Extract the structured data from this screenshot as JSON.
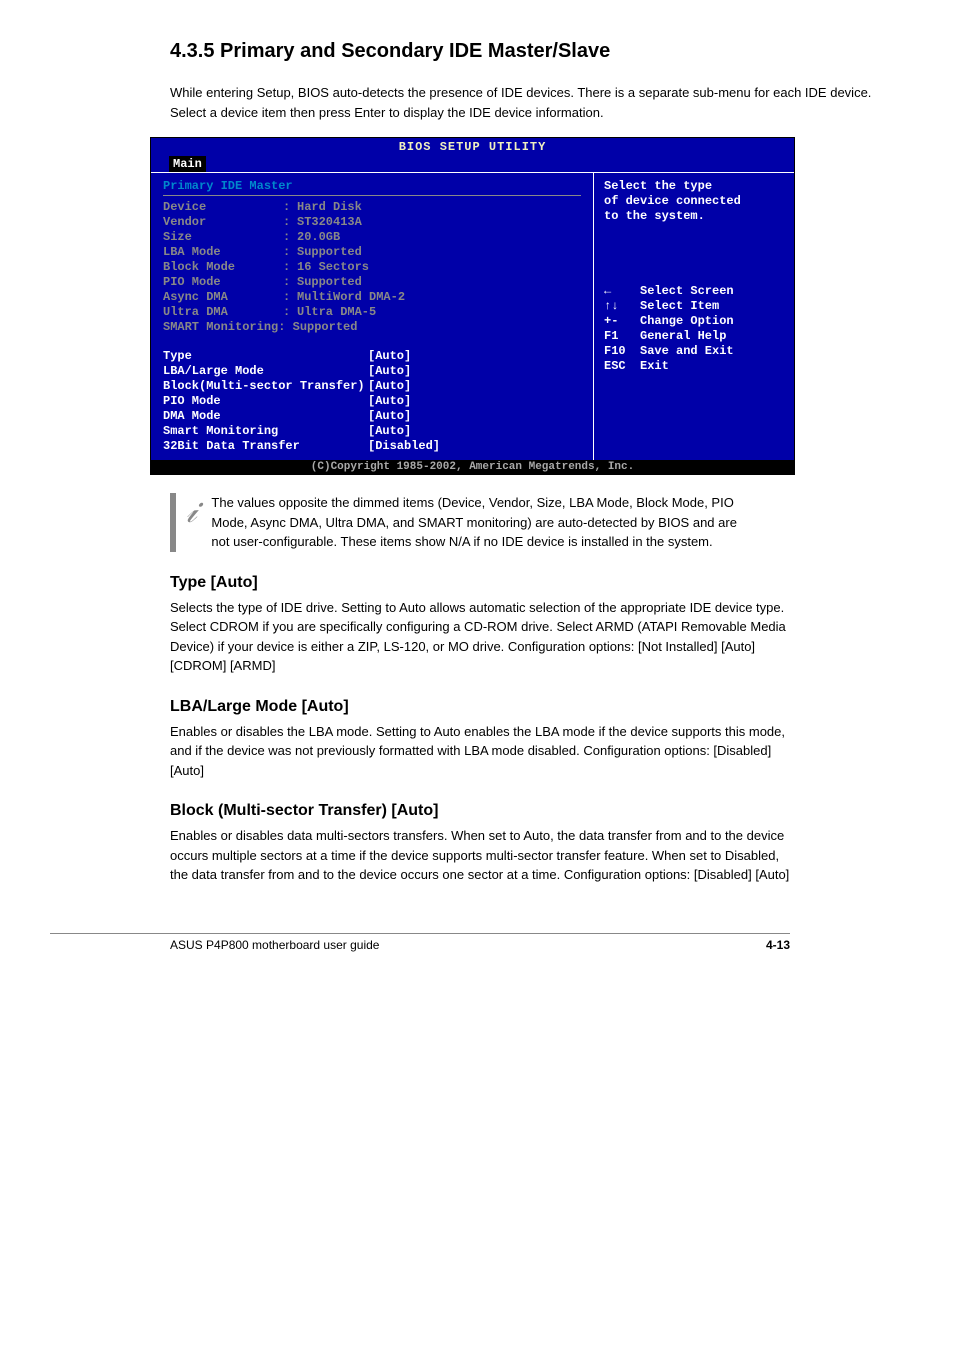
{
  "page": {
    "title": "4.3.5  Primary and Secondary IDE Master/Slave",
    "intro": "While entering Setup, BIOS auto-detects the presence of IDE devices. There is a separate sub-menu for each IDE device. Select a device item then press Enter to display the IDE device information."
  },
  "bios": {
    "title": "BIOS SETUP UTILITY",
    "tab": "Main",
    "section_title": "Primary IDE Master",
    "info": [
      {
        "label": "Device",
        "value": "Hard Disk"
      },
      {
        "label": "Vendor",
        "value": "ST320413A"
      },
      {
        "label": "Size",
        "value": "20.0GB"
      },
      {
        "label": "LBA Mode",
        "value": "Supported"
      },
      {
        "label": "Block Mode",
        "value": "16 Sectors"
      },
      {
        "label": "PIO Mode",
        "value": "Supported"
      },
      {
        "label": "Async DMA",
        "value": "MultiWord DMA-2"
      },
      {
        "label": "Ultra DMA",
        "value": "Ultra DMA-5"
      },
      {
        "label": "SMART Monitoring",
        "value": "Supported",
        "nogap": true
      }
    ],
    "settings": [
      {
        "label": "Type",
        "value": "[Auto]"
      },
      {
        "label": "LBA/Large Mode",
        "value": "[Auto]"
      },
      {
        "label": "Block(Multi-sector Transfer)",
        "value": "[Auto]"
      },
      {
        "label": "PIO Mode",
        "value": "[Auto]"
      },
      {
        "label": "DMA Mode",
        "value": "[Auto]"
      },
      {
        "label": "Smart Monitoring",
        "value": "[Auto]"
      },
      {
        "label": "32Bit Data Transfer",
        "value": "[Disabled]"
      }
    ],
    "help": {
      "line1": "Select the type",
      "line2": "of device connected",
      "line3": "to the system."
    },
    "nav": [
      {
        "key": "←",
        "desc": "Select Screen"
      },
      {
        "key": "↑↓",
        "desc": "Select Item"
      },
      {
        "key": "+-",
        "desc": "Change Option"
      },
      {
        "key": "F1",
        "desc": "General Help"
      },
      {
        "key": "F10",
        "desc": "Save and Exit"
      },
      {
        "key": "ESC",
        "desc": "Exit"
      }
    ],
    "footer": "(C)Copyright 1985-2002, American Megatrends, Inc."
  },
  "note": "The values opposite the dimmed items (Device, Vendor, Size, LBA Mode, Block Mode, PIO Mode, Async DMA, Ultra DMA, and SMART monitoring) are auto-detected by BIOS and are not user-configurable. These items show N/A if no IDE device is installed in the system.",
  "sections": [
    {
      "heading": "Type [Auto]",
      "body": "Selects the type of IDE drive. Setting to Auto allows automatic selection of the appropriate IDE device type. Select CDROM if you are specifically configuring a CD-ROM drive. Select ARMD (ATAPI Removable Media Device) if your device is either a ZIP, LS-120, or MO drive. Configuration options: [Not Installed] [Auto] [CDROM] [ARMD]"
    },
    {
      "heading": "LBA/Large Mode [Auto]",
      "body": "Enables or disables the LBA mode. Setting to Auto enables the LBA mode if the device supports this mode, and if the device was not previously formatted with LBA mode disabled. Configuration options: [Disabled] [Auto]"
    },
    {
      "heading": "Block (Multi-sector Transfer) [Auto]",
      "body": "Enables or disables data multi-sectors transfers. When set to Auto, the data transfer from and to the device occurs multiple sectors at a time if the device supports multi-sector transfer feature. When set to Disabled, the data transfer from and to the device occurs one sector at a time. Configuration options: [Disabled] [Auto]"
    }
  ],
  "footer": {
    "left": "ASUS P4P800 motherboard user guide",
    "right": "4-13"
  }
}
